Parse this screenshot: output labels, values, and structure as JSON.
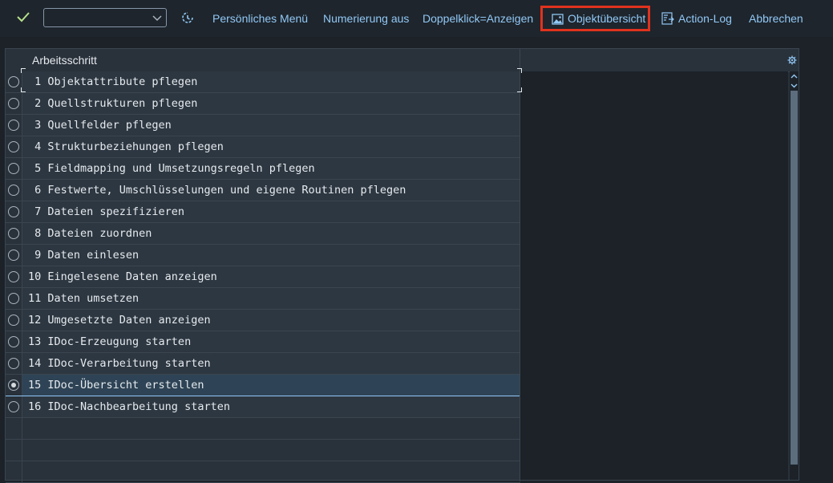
{
  "toolbar": {
    "select_value": "",
    "buttons": [
      {
        "label": "Persönliches Menü"
      },
      {
        "label": "Numerierung aus"
      },
      {
        "label": "Doppelklick=Anzeigen"
      },
      {
        "label": "Objektübersicht",
        "icon": "image-icon"
      },
      {
        "label": "Action-Log",
        "icon": "log-icon"
      },
      {
        "label": "Abbrechen"
      }
    ]
  },
  "table": {
    "header": "Arbeitsschritt",
    "selected_index": 14,
    "rows": [
      " 1 Objektattribute pflegen",
      " 2 Quellstrukturen pflegen",
      " 3 Quellfelder pflegen",
      " 4 Strukturbeziehungen pflegen",
      " 5 Fieldmapping und Umsetzungsregeln pflegen",
      " 6 Festwerte, Umschlüsselungen und eigene Routinen pflegen",
      " 7 Dateien spezifizieren",
      " 8 Dateien zuordnen",
      " 9 Daten einlesen",
      "10 Eingelesene Daten anzeigen",
      "11 Daten umsetzen",
      "12 Umgesetzte Daten anzeigen",
      "13 IDoc-Erzeugung starten",
      "14 IDoc-Verarbeitung starten",
      "15 IDoc-Übersicht erstellen",
      "16 IDoc-Nachbearbeitung starten"
    ]
  },
  "colors": {
    "accent": "#91c8f6",
    "highlight": "#e0321e",
    "background": "#1c2228"
  }
}
